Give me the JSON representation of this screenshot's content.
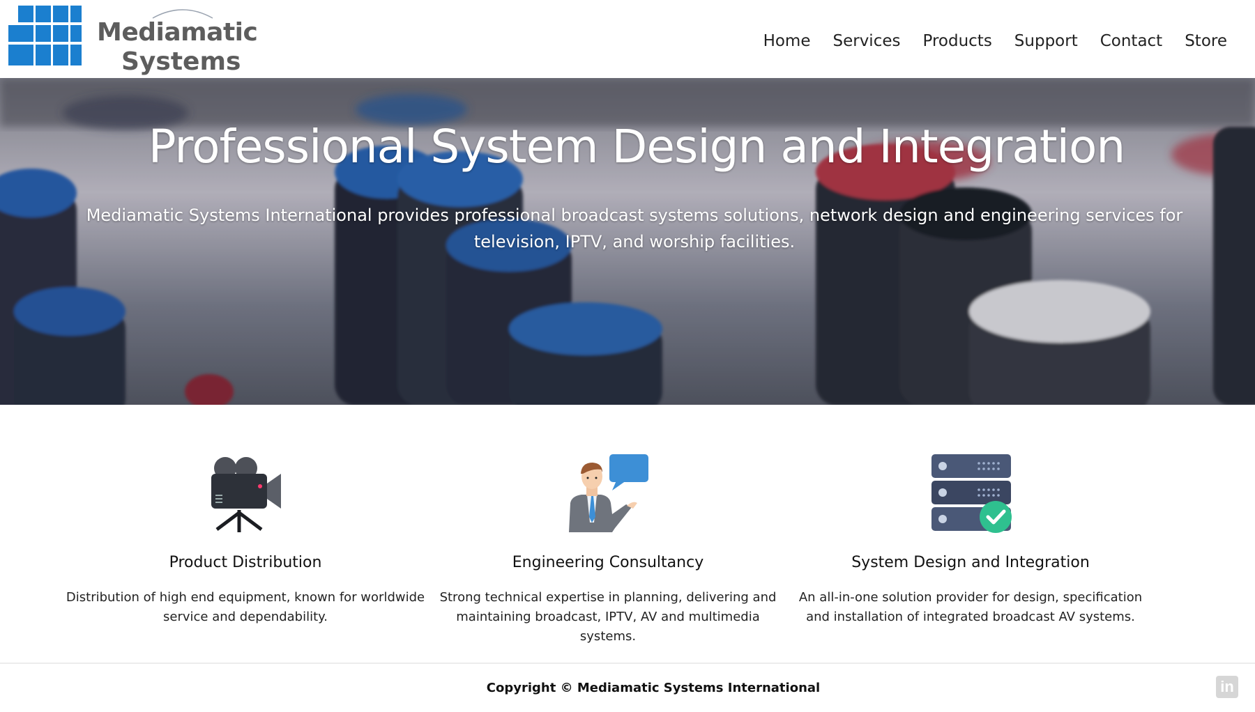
{
  "brand": {
    "line1": "Mediamatic",
    "line2": "Systems"
  },
  "nav": [
    "Home",
    "Services",
    "Products",
    "Support",
    "Contact",
    "Store"
  ],
  "hero": {
    "title": "Professional System Design and Integration",
    "subtitle": "Mediamatic Systems International provides professional broadcast systems solutions, network design and engineering services for television, IPTV, and worship facilities."
  },
  "features": [
    {
      "icon": "video-camera-icon",
      "title": "Product Distribution",
      "text": "Distribution of high end equipment, known for worldwide service and dependability."
    },
    {
      "icon": "consultant-icon",
      "title": "Engineering Consultancy",
      "text": "Strong technical expertise in planning, delivering and maintaining broadcast, IPTV, AV and multimedia systems."
    },
    {
      "icon": "server-check-icon",
      "title": "System Design and Integration",
      "text": "An all-in-one solution provider for design, specification and installation of integrated broadcast AV systems."
    }
  ],
  "footer": {
    "copyright": "Copyright © Mediamatic Systems International",
    "social_icon": "linkedin-icon",
    "social_text": "in"
  },
  "colors": {
    "logo_blue": "#1b7fcf",
    "logo_text": "#5d5d5d",
    "accent_green": "#2fc08f",
    "server": "#4a5877"
  }
}
